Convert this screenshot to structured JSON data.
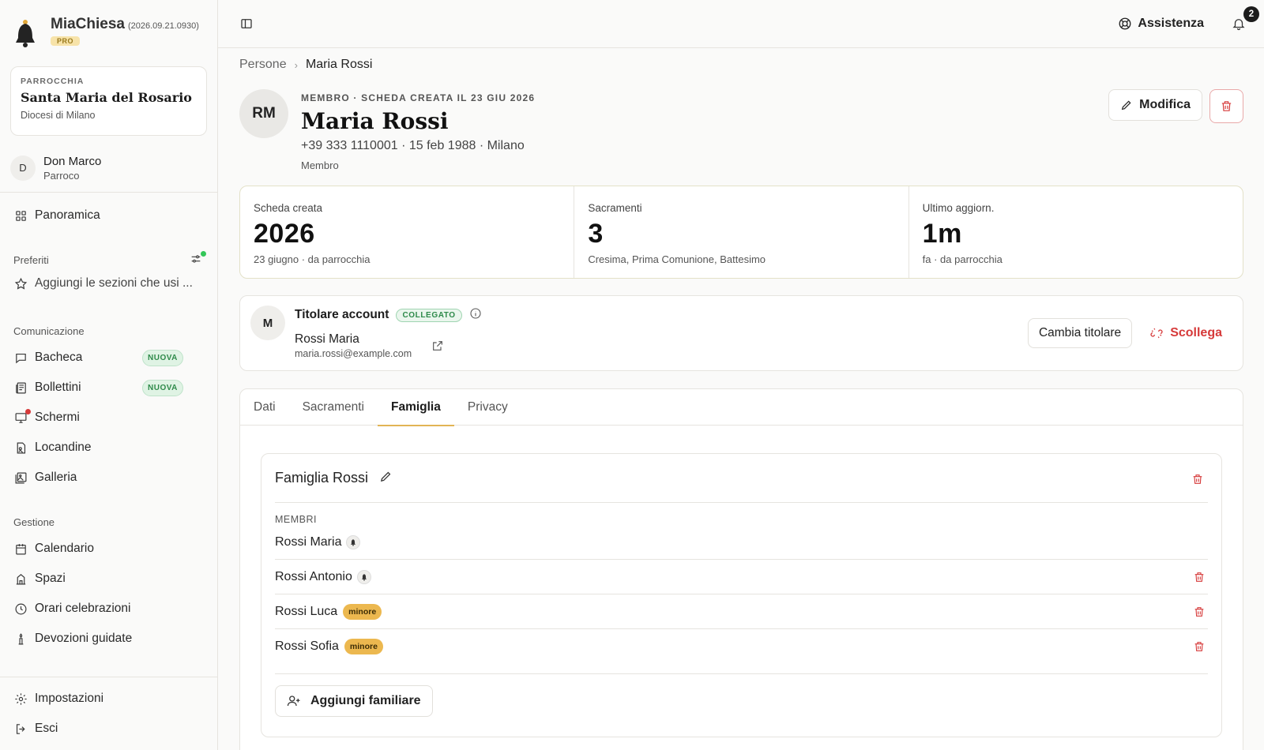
{
  "app": {
    "name": "MiaChiesa",
    "version": "(2026.09.21.0930)",
    "plan": "PRO"
  },
  "parish": {
    "kicker": "PARROCCHIA",
    "name": "Santa Maria del Rosario",
    "diocese": "Diocesi di Milano"
  },
  "user": {
    "initial": "D",
    "name": "Don Marco",
    "role": "Parroco"
  },
  "nav": {
    "overview": "Panoramica",
    "favorites_label": "Preferiti",
    "favorites_add": "Aggiungi le sezioni che usi ...",
    "communication_label": "Comunicazione",
    "communication": [
      {
        "label": "Bacheca",
        "badge": "NUOVA"
      },
      {
        "label": "Bollettini",
        "badge": "NUOVA"
      },
      {
        "label": "Schermi"
      },
      {
        "label": "Locandine"
      },
      {
        "label": "Galleria"
      }
    ],
    "management_label": "Gestione",
    "management": [
      {
        "label": "Calendario"
      },
      {
        "label": "Spazi"
      },
      {
        "label": "Orari celebrazioni"
      },
      {
        "label": "Devozioni guidate"
      }
    ],
    "settings": "Impostazioni",
    "logout": "Esci"
  },
  "topbar": {
    "help": "Assistenza",
    "notifications_count": "2"
  },
  "breadcrumb": {
    "parent": "Persone",
    "current": "Maria Rossi"
  },
  "person": {
    "initials": "RM",
    "kicker": "MEMBRO · SCHEDA CREATA IL 23 GIU 2026",
    "name": "Maria Rossi",
    "meta": "+39 333 1110001 · 15 feb 1988 · Milano",
    "role": "Membro",
    "edit_label": "Modifica"
  },
  "stats": [
    {
      "label": "Scheda creata",
      "value": "2026",
      "sub": "23 giugno · da parrocchia"
    },
    {
      "label": "Sacramenti",
      "value": "3",
      "sub": "Cresima, Prima Comunione, Battesimo"
    },
    {
      "label": "Ultimo aggiorn.",
      "value": "1m",
      "sub": "fa · da parrocchia"
    }
  ],
  "account": {
    "initial": "M",
    "title": "Titolare account",
    "status": "COLLEGATO",
    "name": "Rossi Maria",
    "email": "maria.rossi@example.com",
    "change_label": "Cambia titolare",
    "unlink_label": "Scollega"
  },
  "tabs": [
    {
      "label": "Dati"
    },
    {
      "label": "Sacramenti"
    },
    {
      "label": "Famiglia",
      "active": true
    },
    {
      "label": "Privacy"
    }
  ],
  "family": {
    "title": "Famiglia Rossi",
    "members_label": "MEMBRI",
    "members": [
      {
        "name": "Rossi Maria",
        "bell": true
      },
      {
        "name": "Rossi Antonio",
        "bell": true
      },
      {
        "name": "Rossi Luca",
        "badge": "minore"
      },
      {
        "name": "Rossi Sofia",
        "badge": "minore"
      }
    ],
    "add_label": "Aggiungi familiare"
  }
}
